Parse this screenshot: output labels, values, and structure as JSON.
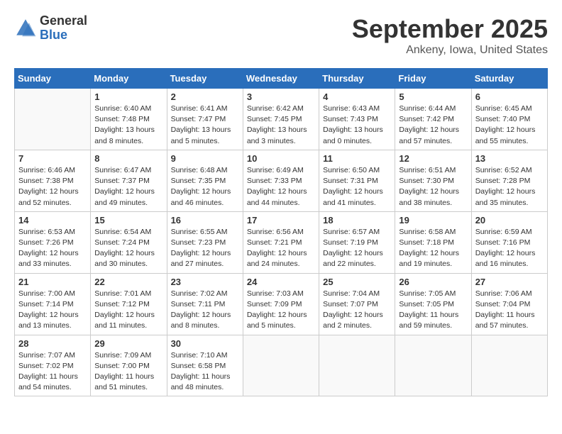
{
  "header": {
    "logo_general": "General",
    "logo_blue": "Blue",
    "title": "September 2025",
    "location": "Ankeny, Iowa, United States"
  },
  "days_of_week": [
    "Sunday",
    "Monday",
    "Tuesday",
    "Wednesday",
    "Thursday",
    "Friday",
    "Saturday"
  ],
  "weeks": [
    [
      {
        "day": "",
        "content": ""
      },
      {
        "day": "1",
        "content": "Sunrise: 6:40 AM\nSunset: 7:48 PM\nDaylight: 13 hours\nand 8 minutes."
      },
      {
        "day": "2",
        "content": "Sunrise: 6:41 AM\nSunset: 7:47 PM\nDaylight: 13 hours\nand 5 minutes."
      },
      {
        "day": "3",
        "content": "Sunrise: 6:42 AM\nSunset: 7:45 PM\nDaylight: 13 hours\nand 3 minutes."
      },
      {
        "day": "4",
        "content": "Sunrise: 6:43 AM\nSunset: 7:43 PM\nDaylight: 13 hours\nand 0 minutes."
      },
      {
        "day": "5",
        "content": "Sunrise: 6:44 AM\nSunset: 7:42 PM\nDaylight: 12 hours\nand 57 minutes."
      },
      {
        "day": "6",
        "content": "Sunrise: 6:45 AM\nSunset: 7:40 PM\nDaylight: 12 hours\nand 55 minutes."
      }
    ],
    [
      {
        "day": "7",
        "content": "Sunrise: 6:46 AM\nSunset: 7:38 PM\nDaylight: 12 hours\nand 52 minutes."
      },
      {
        "day": "8",
        "content": "Sunrise: 6:47 AM\nSunset: 7:37 PM\nDaylight: 12 hours\nand 49 minutes."
      },
      {
        "day": "9",
        "content": "Sunrise: 6:48 AM\nSunset: 7:35 PM\nDaylight: 12 hours\nand 46 minutes."
      },
      {
        "day": "10",
        "content": "Sunrise: 6:49 AM\nSunset: 7:33 PM\nDaylight: 12 hours\nand 44 minutes."
      },
      {
        "day": "11",
        "content": "Sunrise: 6:50 AM\nSunset: 7:31 PM\nDaylight: 12 hours\nand 41 minutes."
      },
      {
        "day": "12",
        "content": "Sunrise: 6:51 AM\nSunset: 7:30 PM\nDaylight: 12 hours\nand 38 minutes."
      },
      {
        "day": "13",
        "content": "Sunrise: 6:52 AM\nSunset: 7:28 PM\nDaylight: 12 hours\nand 35 minutes."
      }
    ],
    [
      {
        "day": "14",
        "content": "Sunrise: 6:53 AM\nSunset: 7:26 PM\nDaylight: 12 hours\nand 33 minutes."
      },
      {
        "day": "15",
        "content": "Sunrise: 6:54 AM\nSunset: 7:24 PM\nDaylight: 12 hours\nand 30 minutes."
      },
      {
        "day": "16",
        "content": "Sunrise: 6:55 AM\nSunset: 7:23 PM\nDaylight: 12 hours\nand 27 minutes."
      },
      {
        "day": "17",
        "content": "Sunrise: 6:56 AM\nSunset: 7:21 PM\nDaylight: 12 hours\nand 24 minutes."
      },
      {
        "day": "18",
        "content": "Sunrise: 6:57 AM\nSunset: 7:19 PM\nDaylight: 12 hours\nand 22 minutes."
      },
      {
        "day": "19",
        "content": "Sunrise: 6:58 AM\nSunset: 7:18 PM\nDaylight: 12 hours\nand 19 minutes."
      },
      {
        "day": "20",
        "content": "Sunrise: 6:59 AM\nSunset: 7:16 PM\nDaylight: 12 hours\nand 16 minutes."
      }
    ],
    [
      {
        "day": "21",
        "content": "Sunrise: 7:00 AM\nSunset: 7:14 PM\nDaylight: 12 hours\nand 13 minutes."
      },
      {
        "day": "22",
        "content": "Sunrise: 7:01 AM\nSunset: 7:12 PM\nDaylight: 12 hours\nand 11 minutes."
      },
      {
        "day": "23",
        "content": "Sunrise: 7:02 AM\nSunset: 7:11 PM\nDaylight: 12 hours\nand 8 minutes."
      },
      {
        "day": "24",
        "content": "Sunrise: 7:03 AM\nSunset: 7:09 PM\nDaylight: 12 hours\nand 5 minutes."
      },
      {
        "day": "25",
        "content": "Sunrise: 7:04 AM\nSunset: 7:07 PM\nDaylight: 12 hours\nand 2 minutes."
      },
      {
        "day": "26",
        "content": "Sunrise: 7:05 AM\nSunset: 7:05 PM\nDaylight: 11 hours\nand 59 minutes."
      },
      {
        "day": "27",
        "content": "Sunrise: 7:06 AM\nSunset: 7:04 PM\nDaylight: 11 hours\nand 57 minutes."
      }
    ],
    [
      {
        "day": "28",
        "content": "Sunrise: 7:07 AM\nSunset: 7:02 PM\nDaylight: 11 hours\nand 54 minutes."
      },
      {
        "day": "29",
        "content": "Sunrise: 7:09 AM\nSunset: 7:00 PM\nDaylight: 11 hours\nand 51 minutes."
      },
      {
        "day": "30",
        "content": "Sunrise: 7:10 AM\nSunset: 6:58 PM\nDaylight: 11 hours\nand 48 minutes."
      },
      {
        "day": "",
        "content": ""
      },
      {
        "day": "",
        "content": ""
      },
      {
        "day": "",
        "content": ""
      },
      {
        "day": "",
        "content": ""
      }
    ]
  ]
}
